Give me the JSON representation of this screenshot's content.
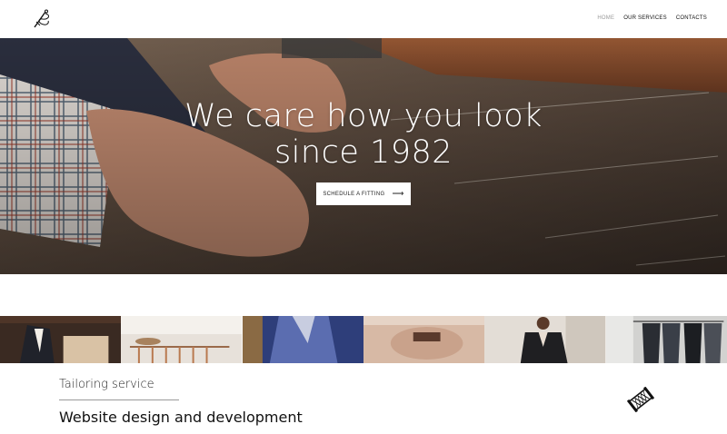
{
  "header": {
    "logo_icon": "needle-thread-icon",
    "nav": [
      {
        "label": "HOME",
        "active": true
      },
      {
        "label": "OUR SERVICES",
        "active": false
      },
      {
        "label": "CONTACTS",
        "active": false
      }
    ]
  },
  "hero": {
    "title": "We care how you look since 1982",
    "cta_label": "SCHEDULE A FITTING",
    "cta_icon": "arrow-right-icon"
  },
  "gallery": {
    "tiles": [
      "suit-mannequin",
      "clothes-rack",
      "blue-jacket",
      "tailor-hands",
      "woman-blazer",
      "hanging-suits"
    ]
  },
  "footer": {
    "service_label": "Tailoring service",
    "project_title": "Website design and development",
    "spool_icon": "thread-spool-icon"
  },
  "colors": {
    "accent": "#111111",
    "nav_active": "#9a9a9a",
    "hero_base": "#5a4a3e"
  }
}
